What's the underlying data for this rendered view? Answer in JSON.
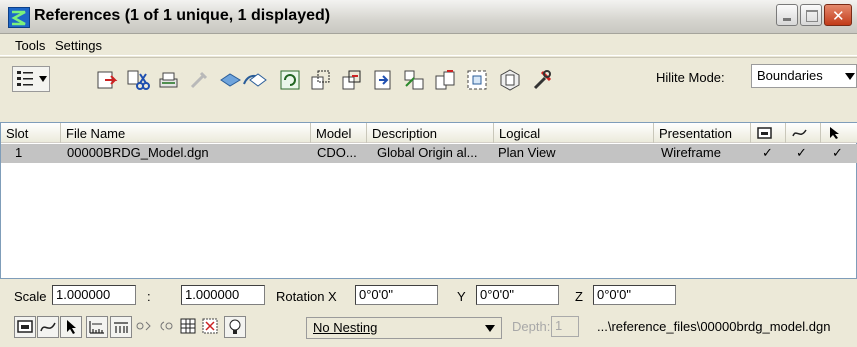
{
  "window": {
    "title": "References (1 of 1 unique, 1 displayed)"
  },
  "menu": {
    "tools": "Tools",
    "settings": "Settings"
  },
  "toolbar": {
    "hilite_label": "Hilite Mode:",
    "hilite_value": "Boundaries"
  },
  "table": {
    "headers": [
      "Slot",
      "File Name",
      "Model",
      "Description",
      "Logical",
      "Presentation"
    ],
    "rows": [
      {
        "slot": "1",
        "file": "00000BRDG_Model.dgn",
        "model": "CDO...",
        "desc": "Global Origin al...",
        "logical": "Plan View",
        "presentation": "Wireframe",
        "c1": "✓",
        "c2": "✓",
        "c3": "✓"
      }
    ]
  },
  "scale": {
    "label": "Scale",
    "value1": "1.000000",
    "sep": ":",
    "value2": "1.000000",
    "rotation_label": "Rotation X",
    "rot_x": "0°0'0\"",
    "y_label": "Y",
    "rot_y": "0°0'0\"",
    "z_label": "Z",
    "rot_z": "0°0'0\""
  },
  "bottom": {
    "nesting": "No Nesting",
    "depth_label": "Depth:",
    "depth_value": "1",
    "path": "...\\reference_files\\00000brdg_model.dgn"
  }
}
